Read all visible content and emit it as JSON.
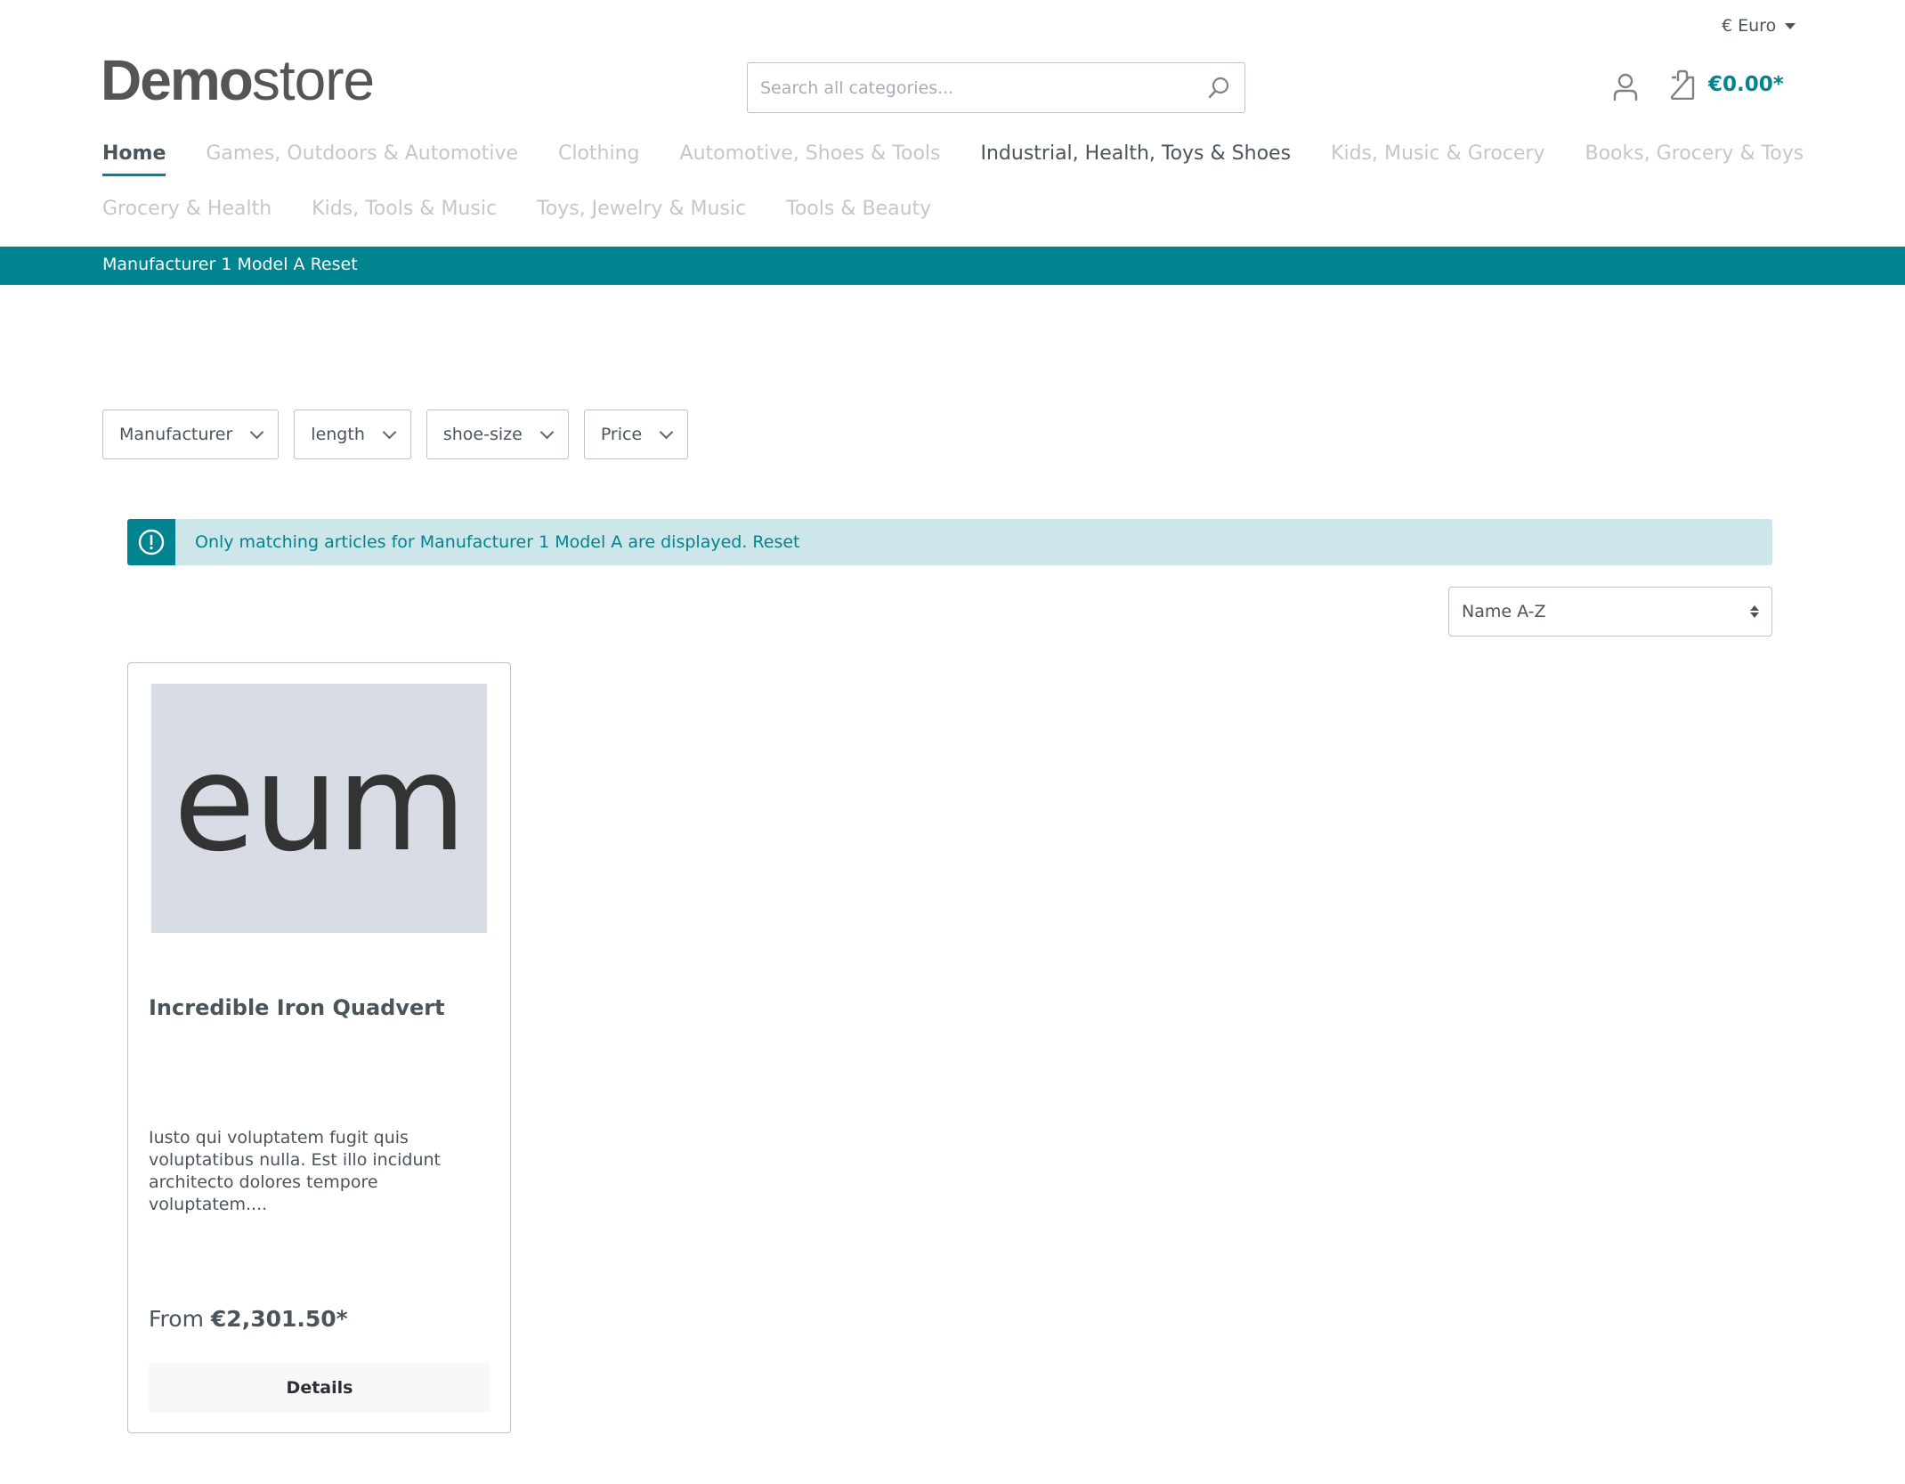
{
  "header": {
    "currency": {
      "symbol": "€",
      "label": "€ Euro"
    },
    "logo": {
      "bold": "Demo",
      "light": "store"
    },
    "search": {
      "placeholder": "Search all categories...",
      "value": ""
    },
    "cart_total": "€0.00*"
  },
  "nav": {
    "row1": [
      {
        "label": "Home",
        "state": "active"
      },
      {
        "label": "Games, Outdoors & Automotive",
        "state": ""
      },
      {
        "label": "Clothing",
        "state": ""
      },
      {
        "label": "Automotive, Shoes & Tools",
        "state": ""
      },
      {
        "label": "Industrial, Health, Toys & Shoes",
        "state": "hover"
      },
      {
        "label": "Kids, Music & Grocery",
        "state": ""
      },
      {
        "label": "Books, Grocery & Toys",
        "state": ""
      }
    ],
    "row2": [
      {
        "label": "Grocery & Health",
        "state": ""
      },
      {
        "label": "Kids, Tools & Music",
        "state": ""
      },
      {
        "label": "Toys, Jewelry & Music",
        "state": ""
      },
      {
        "label": "Tools & Beauty",
        "state": ""
      }
    ]
  },
  "filter_bar": {
    "text": "Manufacturer 1 Model A Reset"
  },
  "filters": [
    {
      "label": "Manufacturer"
    },
    {
      "label": "length"
    },
    {
      "label": "shoe-size"
    },
    {
      "label": "Price"
    }
  ],
  "alert": {
    "text": "Only matching articles for Manufacturer 1 Model A are displayed. Reset"
  },
  "sort": {
    "selected": "Name A-Z"
  },
  "colors": {
    "accent": "#008490",
    "alert_bg": "#cce6ea",
    "text": "#4a545b",
    "nav_inactive": "#c3c7cb"
  },
  "products": [
    {
      "image_text": "eum",
      "name": "Incredible Iron Quadvert",
      "description": "Iusto qui voluptatem fugit quis voluptatibus nulla. Est illo incidunt architecto dolores tempore voluptatem....",
      "price_prefix": "From",
      "price": "€2,301.50*",
      "button_label": "Details"
    }
  ]
}
